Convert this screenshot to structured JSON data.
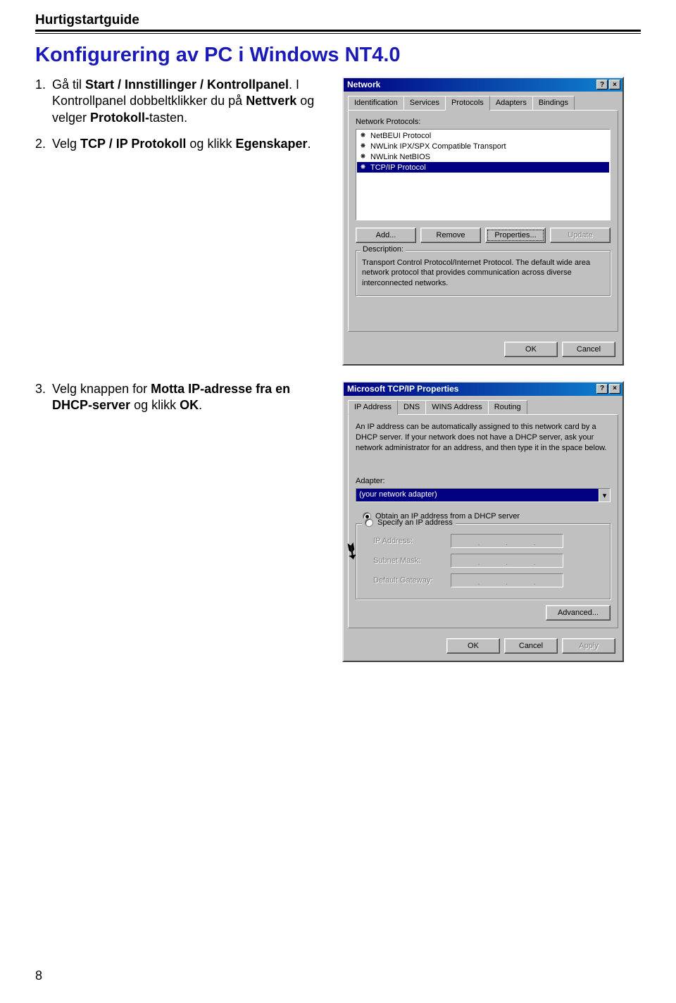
{
  "header": "Hurtigstartguide",
  "title": "Konfigurering av PC i Windows NT4.0",
  "steps": [
    {
      "num": "1.",
      "parts": [
        "Gå til ",
        "Start / Innstillinger / Kontrollpanel",
        ".  I Kontrollpanel dobbeltklikker du på ",
        "Nettverk",
        " og velger ",
        "Protokoll-",
        "tasten."
      ]
    },
    {
      "num": "2.",
      "parts": [
        "Velg ",
        "TCP / IP Protokoll",
        " og klikk ",
        "Egenskaper",
        "."
      ]
    },
    {
      "num": "3.",
      "parts": [
        "Velg knappen for ",
        "Motta IP-adresse fra en DHCP-server",
        " og klikk ",
        "OK",
        "."
      ]
    }
  ],
  "dialog1": {
    "title": "Network",
    "help": "?",
    "close": "×",
    "tabs": [
      "Identification",
      "Services",
      "Protocols",
      "Adapters",
      "Bindings"
    ],
    "listLabel": "Network Protocols:",
    "protocols": [
      "NetBEUI Protocol",
      "NWLink IPX/SPX Compatible Transport",
      "NWLink NetBIOS",
      "TCP/IP Protocol"
    ],
    "buttons": {
      "add": "Add...",
      "remove": "Remove",
      "properties": "Properties...",
      "update": "Update"
    },
    "descLabel": "Description:",
    "descText": "Transport Control Protocol/Internet Protocol. The default wide area network protocol that provides communication across diverse interconnected networks.",
    "ok": "OK",
    "cancel": "Cancel"
  },
  "dialog2": {
    "title": "Microsoft TCP/IP Properties",
    "help": "?",
    "close": "×",
    "tabs": [
      "IP Address",
      "DNS",
      "WINS Address",
      "Routing"
    ],
    "info": "An IP address can be automatically assigned to this network card by a DHCP server. If your network does not have a DHCP server, ask your network administrator for an address, and then type it in the space below.",
    "adapterLabel": "Adapter:",
    "adapterValue": "(your network adapter)",
    "radioObtain": "Obtain an IP address from a DHCP server",
    "radioSpecify": "Specify an IP address",
    "ipAddress": "IP Address:",
    "subnetMask": "Subnet Mask:",
    "defaultGateway": "Default Gateway:",
    "advanced": "Advanced...",
    "ok": "OK",
    "cancel": "Cancel",
    "apply": "Apply"
  },
  "pageNum": "8"
}
